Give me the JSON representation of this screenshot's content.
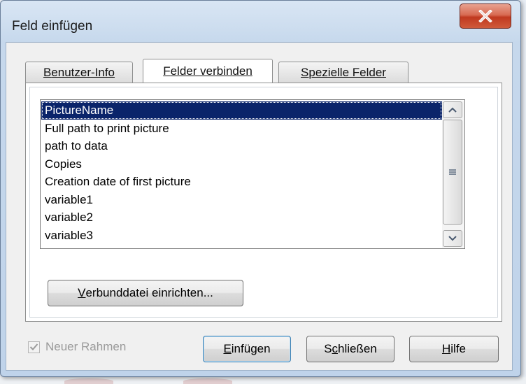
{
  "window": {
    "title": "Feld einfügen"
  },
  "tabs": [
    {
      "label": "Benutzer-Info",
      "mnemonic": "B",
      "rest": "enutzer-Info",
      "active": false
    },
    {
      "label": "Felder verbinden",
      "mnemonic": "F",
      "rest": "elder verbinden",
      "active": true
    },
    {
      "label": "Spezielle Felder",
      "mnemonic": "S",
      "rest": "pezielle Felder",
      "active": false
    }
  ],
  "list": {
    "items": [
      "PictureName",
      "Full path to print picture",
      "path to data",
      "Copies",
      "Creation date of first picture",
      "variable1",
      "variable2",
      "variable3"
    ],
    "selected_index": 0
  },
  "buttons": {
    "setup_datasource": {
      "label": "Verbunddatei einrichten...",
      "mnemonic": "V",
      "rest": "erbunddatei einrichten..."
    },
    "insert": {
      "label": "Einfügen",
      "mnemonic": "E",
      "rest": "infügen"
    },
    "close": {
      "label": "Schließen",
      "before": "S",
      "mnemonic": "c",
      "rest": "hließen"
    },
    "help": {
      "label": "Hilfe",
      "mnemonic": "H",
      "rest": "ilfe"
    }
  },
  "checkbox": {
    "label": "Neuer Rahmen",
    "checked": true,
    "enabled": false
  },
  "icons": {
    "close": "close-x-icon",
    "scroll_up": "chevron-up-icon",
    "scroll_down": "chevron-down-icon",
    "thumb_grip": "grip-icon",
    "check": "checkmark-icon"
  },
  "colors": {
    "selection": "#0a246a",
    "close_button": "#c0391f",
    "default_button_border": "#3c7fb1"
  }
}
